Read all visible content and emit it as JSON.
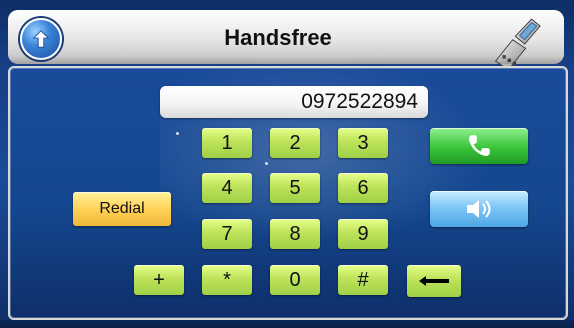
{
  "header": {
    "title": "Handsfree",
    "icons": {
      "up": "arrow-up-icon",
      "phone": "flip-phone-icon",
      "small_speaker": "speaker-icon"
    }
  },
  "display": {
    "number": "0972522894"
  },
  "buttons": {
    "redial_label": "Redial",
    "call_icon": "phone-call-icon",
    "speaker_icon": "speaker-icon",
    "backspace_icon": "backspace-arrow-icon"
  },
  "keypad": {
    "keys": [
      "1",
      "2",
      "3",
      "4",
      "5",
      "6",
      "7",
      "8",
      "9",
      "+",
      "*",
      "0",
      "#"
    ]
  },
  "colors": {
    "background": "#1b4c99",
    "key_green": "#bde35a",
    "call_green": "#39c43b",
    "redial_yellow": "#ffd257",
    "speaker_blue": "#7fc6f4"
  }
}
